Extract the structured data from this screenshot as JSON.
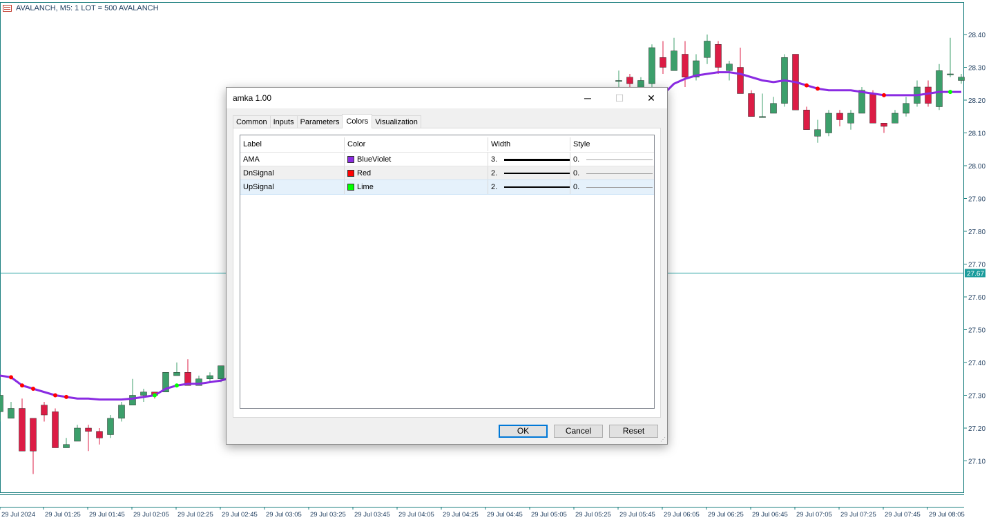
{
  "chart": {
    "title": "AVALANCH, M5:  1 LOT = 500 AVALANCH",
    "price_ticks": [
      "28.40",
      "28.30",
      "28.20",
      "28.10",
      "28.00",
      "27.90",
      "27.80",
      "27.70",
      "27.60",
      "27.50",
      "27.40",
      "27.30",
      "27.20",
      "27.10"
    ],
    "current_price_label": "27.67",
    "time_ticks": [
      "29 Jul 2024",
      "29 Jul 01:25",
      "29 Jul 01:45",
      "29 Jul 02:05",
      "29 Jul 02:25",
      "29 Jul 02:45",
      "29 Jul 03:05",
      "29 Jul 03:25",
      "29 Jul 03:45",
      "29 Jul 04:05",
      "29 Jul 04:25",
      "29 Jul 04:45",
      "29 Jul 05:05",
      "29 Jul 05:25",
      "29 Jul 05:45",
      "29 Jul 06:05",
      "29 Jul 06:25",
      "29 Jul 06:45",
      "29 Jul 07:05",
      "29 Jul 07:25",
      "29 Jul 07:45",
      "29 Jul 08:05"
    ],
    "colors": {
      "bull": "#3c9f6b",
      "bear": "#dc1c45",
      "ama_line": "#8a2be2",
      "down_dot": "#ff0000",
      "up_dot": "#00ff00",
      "axis": "#1b7f7f",
      "hline": "#1b9c9c"
    }
  },
  "dialog": {
    "title": "amka 1.00",
    "tabs": [
      {
        "label": "Common",
        "active": false
      },
      {
        "label": "Inputs",
        "active": false
      },
      {
        "label": "Parameters",
        "active": false
      },
      {
        "label": "Colors",
        "active": true
      },
      {
        "label": "Visualization",
        "active": false
      }
    ],
    "columns": {
      "label": "Label",
      "color": "Color",
      "width": "Width",
      "style": "Style"
    },
    "rows": [
      {
        "label": "AMA",
        "color_name": "BlueViolet",
        "swatch": "#8a2be2",
        "width_value": "3.",
        "style_value": "0."
      },
      {
        "label": "DnSignal",
        "color_name": "Red",
        "swatch": "#ff0000",
        "width_value": "2.",
        "style_value": "0."
      },
      {
        "label": "UpSignal",
        "color_name": "Lime",
        "swatch": "#00ff00",
        "width_value": "2.",
        "style_value": "0."
      }
    ],
    "buttons": {
      "ok": "OK",
      "cancel": "Cancel",
      "reset": "Reset"
    },
    "window_controls": {
      "minimize": "─",
      "maximize": "☐",
      "close": "✕"
    }
  }
}
